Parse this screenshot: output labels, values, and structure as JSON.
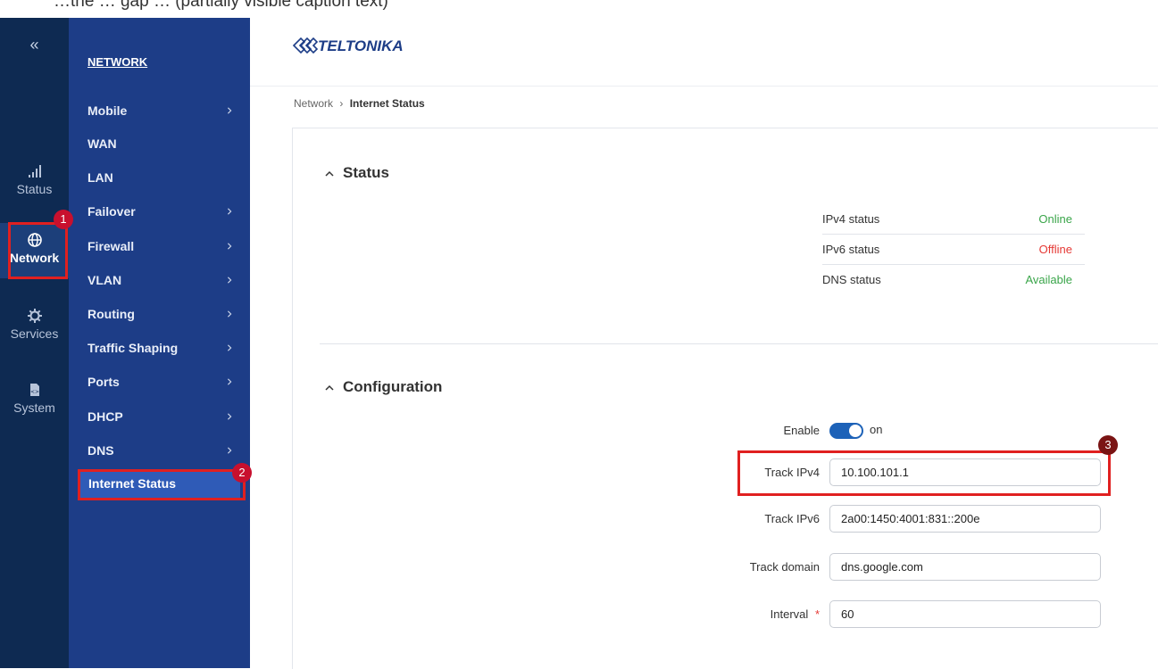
{
  "caption": "…the … gap … (partially visible caption text)",
  "rail": {
    "collapse": "«",
    "items": [
      {
        "label": "Status",
        "icon": "signal-icon"
      },
      {
        "label": "Network",
        "icon": "globe-icon"
      },
      {
        "label": "Services",
        "icon": "gear-icon"
      },
      {
        "label": "System",
        "icon": "system-icon"
      }
    ]
  },
  "submenu": {
    "title": "NETWORK",
    "items": [
      {
        "label": "Mobile",
        "chevron": true
      },
      {
        "label": "WAN",
        "chevron": false
      },
      {
        "label": "LAN",
        "chevron": false
      },
      {
        "label": "Failover",
        "chevron": true
      },
      {
        "label": "Firewall",
        "chevron": true
      },
      {
        "label": "VLAN",
        "chevron": true
      },
      {
        "label": "Routing",
        "chevron": true
      },
      {
        "label": "Traffic Shaping",
        "chevron": true
      },
      {
        "label": "Ports",
        "chevron": true
      },
      {
        "label": "DHCP",
        "chevron": true
      },
      {
        "label": "DNS",
        "chevron": true
      },
      {
        "label": "Internet Status",
        "chevron": false
      }
    ]
  },
  "header": {
    "logo": "TELTONIKA"
  },
  "breadcrumb": {
    "parent": "Network",
    "sep": "›",
    "current": "Internet Status"
  },
  "status": {
    "title": "Status",
    "rows": [
      {
        "key": "IPv4 status",
        "value": "Online",
        "color": "#3aa54a"
      },
      {
        "key": "IPv6 status",
        "value": "Offline",
        "color": "#e53935"
      },
      {
        "key": "DNS status",
        "value": "Available",
        "color": "#3aa54a"
      }
    ]
  },
  "configuration": {
    "title": "Configuration",
    "enable_label": "Enable",
    "enable_state": "on",
    "track_ipv4_label": "Track IPv4",
    "track_ipv4_value": "10.100.101.1",
    "track_ipv6_label": "Track IPv6",
    "track_ipv6_value": "2a00:1450:4001:831::200e",
    "track_domain_label": "Track domain",
    "track_domain_value": "dns.google.com",
    "interval_label": "Interval",
    "interval_required": "*",
    "interval_value": "60"
  },
  "callouts": [
    "1",
    "2",
    "3"
  ],
  "colors": {
    "rail_bg": "#0e2a52",
    "submenu_bg": "#1d3d87",
    "active_item": "#2f5bb7",
    "callout_red": "#e02020",
    "toggle_on": "#1d62b8"
  }
}
